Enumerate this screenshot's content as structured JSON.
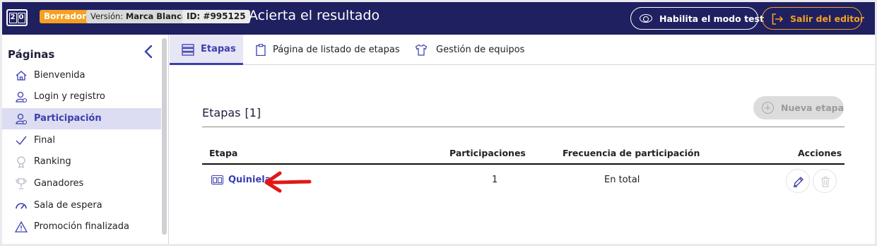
{
  "header": {
    "logo_digits": [
      "2",
      "0"
    ],
    "draft_badge": "Borrador",
    "version_prefix": "Versión:",
    "version_name": "Marca Blanca",
    "id_badge": "ID: #995125",
    "title": "Acierta el resultado",
    "test_mode_button": "Habilita el modo test",
    "exit_button": "Salir del editor",
    "colors": {
      "bar": "#1f2060",
      "accent": "#f5a020",
      "primary": "#3a3eb0"
    }
  },
  "sidebar": {
    "title": "Páginas",
    "items": [
      {
        "label": "Bienvenida",
        "icon": "home-icon",
        "active": false
      },
      {
        "label": "Login y registro",
        "icon": "user-login-icon",
        "active": false
      },
      {
        "label": "Participación",
        "icon": "user-participation-icon",
        "active": true
      },
      {
        "label": "Final",
        "icon": "check-icon",
        "active": false
      },
      {
        "label": "Ranking",
        "icon": "medal-icon",
        "active": false
      },
      {
        "label": "Ganadores",
        "icon": "trophy-icon",
        "active": false
      },
      {
        "label": "Sala de espera",
        "icon": "speedometer-icon",
        "active": false
      },
      {
        "label": "Promoción finalizada",
        "icon": "warning-icon",
        "active": false
      }
    ]
  },
  "tabs": [
    {
      "label": "Etapas",
      "icon": "list-icon",
      "active": true
    },
    {
      "label": "Página de listado de etapas",
      "icon": "clipboard-icon",
      "active": false
    },
    {
      "label": "Gestión de equipos",
      "icon": "shirt-icon",
      "active": false
    }
  ],
  "main": {
    "section_title": "Etapas",
    "section_count": "[1]",
    "new_button": "Nueva etapa",
    "table": {
      "columns": [
        "Etapa",
        "Participaciones",
        "Frecuencia de participación",
        "Acciones"
      ],
      "rows": [
        {
          "name": "Quiniela",
          "participations": "1",
          "frequency": "En total"
        }
      ]
    }
  }
}
